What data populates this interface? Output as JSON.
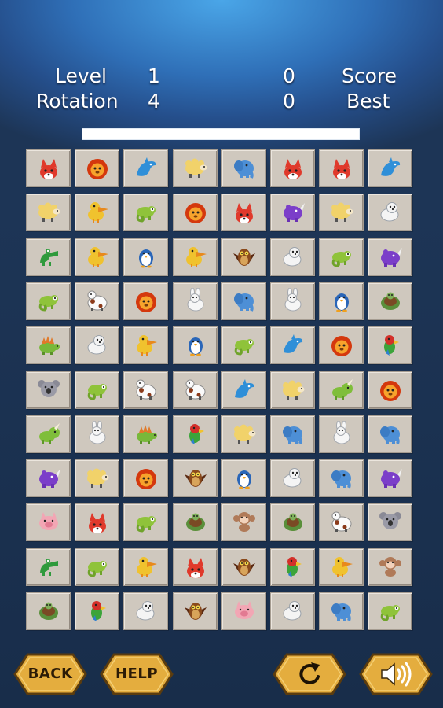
{
  "hud": {
    "level_label": "Level",
    "level_value": "1",
    "rotation_label": "Rotation",
    "rotation_value": "4",
    "score_label": "Score",
    "score_value": "0",
    "best_label": "Best",
    "best_value": "0"
  },
  "progress": {
    "fill_fraction": 1.0
  },
  "colors": {
    "tile": "#cfc8be",
    "button_gold": "#e4ad3e",
    "button_text": "#2b1b06",
    "hud_text": "#ffffff"
  },
  "buttons": {
    "back": "BACK",
    "help": "HELP",
    "restart_icon": "rotate-icon",
    "sound_icon": "speaker-icon"
  },
  "board": {
    "columns": 8,
    "rows": 11,
    "tiles": [
      [
        "fox",
        "lion",
        "dolphin",
        "sheep",
        "elephant",
        "fox",
        "fox",
        "dolphin"
      ],
      [
        "sheep",
        "pelican",
        "chameleon",
        "lion",
        "fox",
        "rhino",
        "sheep",
        "seal"
      ],
      [
        "crocodile",
        "pelican",
        "penguin",
        "pelican",
        "owl",
        "seal",
        "chameleon",
        "rhino"
      ],
      [
        "chameleon",
        "cow",
        "lion",
        "rabbit",
        "elephant",
        "rabbit",
        "penguin",
        "turtle"
      ],
      [
        "stegosaurus",
        "seal",
        "pelican",
        "penguin",
        "chameleon",
        "dolphin",
        "lion",
        "parrot"
      ],
      [
        "koala",
        "chameleon",
        "cow",
        "cow",
        "dolphin",
        "sheep",
        "triceratops",
        "lion"
      ],
      [
        "triceratops",
        "rabbit",
        "stegosaurus",
        "parrot",
        "sheep",
        "elephant",
        "rabbit",
        "elephant"
      ],
      [
        "rhino",
        "sheep",
        "lion",
        "owl",
        "penguin",
        "seal",
        "elephant",
        "rhino"
      ],
      [
        "pig",
        "fox",
        "chameleon",
        "turtle",
        "monkey",
        "turtle",
        "cow",
        "koala"
      ],
      [
        "crocodile",
        "chameleon",
        "pelican",
        "fox",
        "owl",
        "parrot",
        "pelican",
        "monkey"
      ],
      [
        "turtle",
        "parrot",
        "seal",
        "owl",
        "pig",
        "seal",
        "elephant",
        "chameleon"
      ]
    ]
  }
}
